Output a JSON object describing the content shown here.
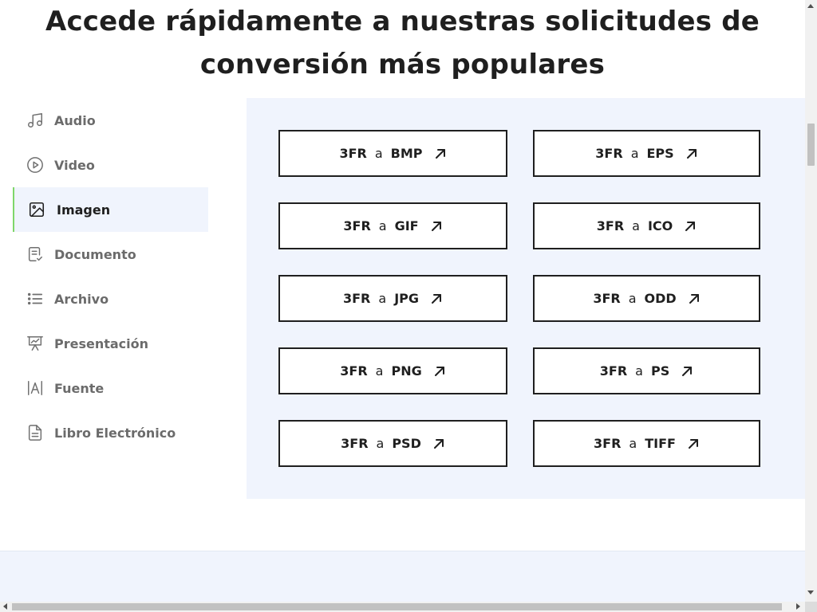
{
  "heading": {
    "line1": "Accede rápidamente a nuestras solicitudes de",
    "line2": "conversión más populares"
  },
  "sidebar": {
    "items": [
      {
        "label": "Audio",
        "icon": "music-note-icon"
      },
      {
        "label": "Video",
        "icon": "play-circle-icon"
      },
      {
        "label": "Imagen",
        "icon": "image-icon",
        "active": true
      },
      {
        "label": "Documento",
        "icon": "document-check-icon"
      },
      {
        "label": "Archivo",
        "icon": "list-icon"
      },
      {
        "label": "Presentación",
        "icon": "presentation-icon"
      },
      {
        "label": "Fuente",
        "icon": "font-icon"
      },
      {
        "label": "Libro Electrónico",
        "icon": "ebook-icon"
      }
    ]
  },
  "conversions": [
    {
      "from": "3FR",
      "sep": "a",
      "to": "BMP"
    },
    {
      "from": "3FR",
      "sep": "a",
      "to": "EPS"
    },
    {
      "from": "3FR",
      "sep": "a",
      "to": "GIF"
    },
    {
      "from": "3FR",
      "sep": "a",
      "to": "ICO"
    },
    {
      "from": "3FR",
      "sep": "a",
      "to": "JPG"
    },
    {
      "from": "3FR",
      "sep": "a",
      "to": "ODD"
    },
    {
      "from": "3FR",
      "sep": "a",
      "to": "PNG"
    },
    {
      "from": "3FR",
      "sep": "a",
      "to": "PS"
    },
    {
      "from": "3FR",
      "sep": "a",
      "to": "PSD"
    },
    {
      "from": "3FR",
      "sep": "a",
      "to": "TIFF"
    }
  ],
  "colors": {
    "accent_active": "#7fd66a",
    "panel_bg": "#f0f4fd",
    "text": "#1f1f1f",
    "muted": "#6b6b6b"
  }
}
